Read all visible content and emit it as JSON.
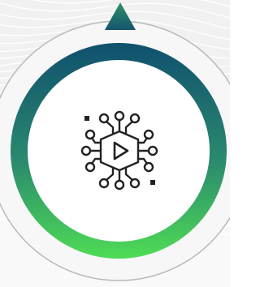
{
  "icon": {
    "name": "circuit-play-icon",
    "stroke_color": "#222222"
  },
  "pointer": {
    "name": "triangle-pointer",
    "color_top": "#2f8f68",
    "color_bottom": "#14546e"
  },
  "ring": {
    "gradient_top": "#10506f",
    "gradient_bottom": "#4fdc55",
    "inner_fill": "#ffffff",
    "outer_outline": "#b8b8b8"
  },
  "background": {
    "base": "#f1f1f1",
    "wave_color": "#ffffff"
  }
}
